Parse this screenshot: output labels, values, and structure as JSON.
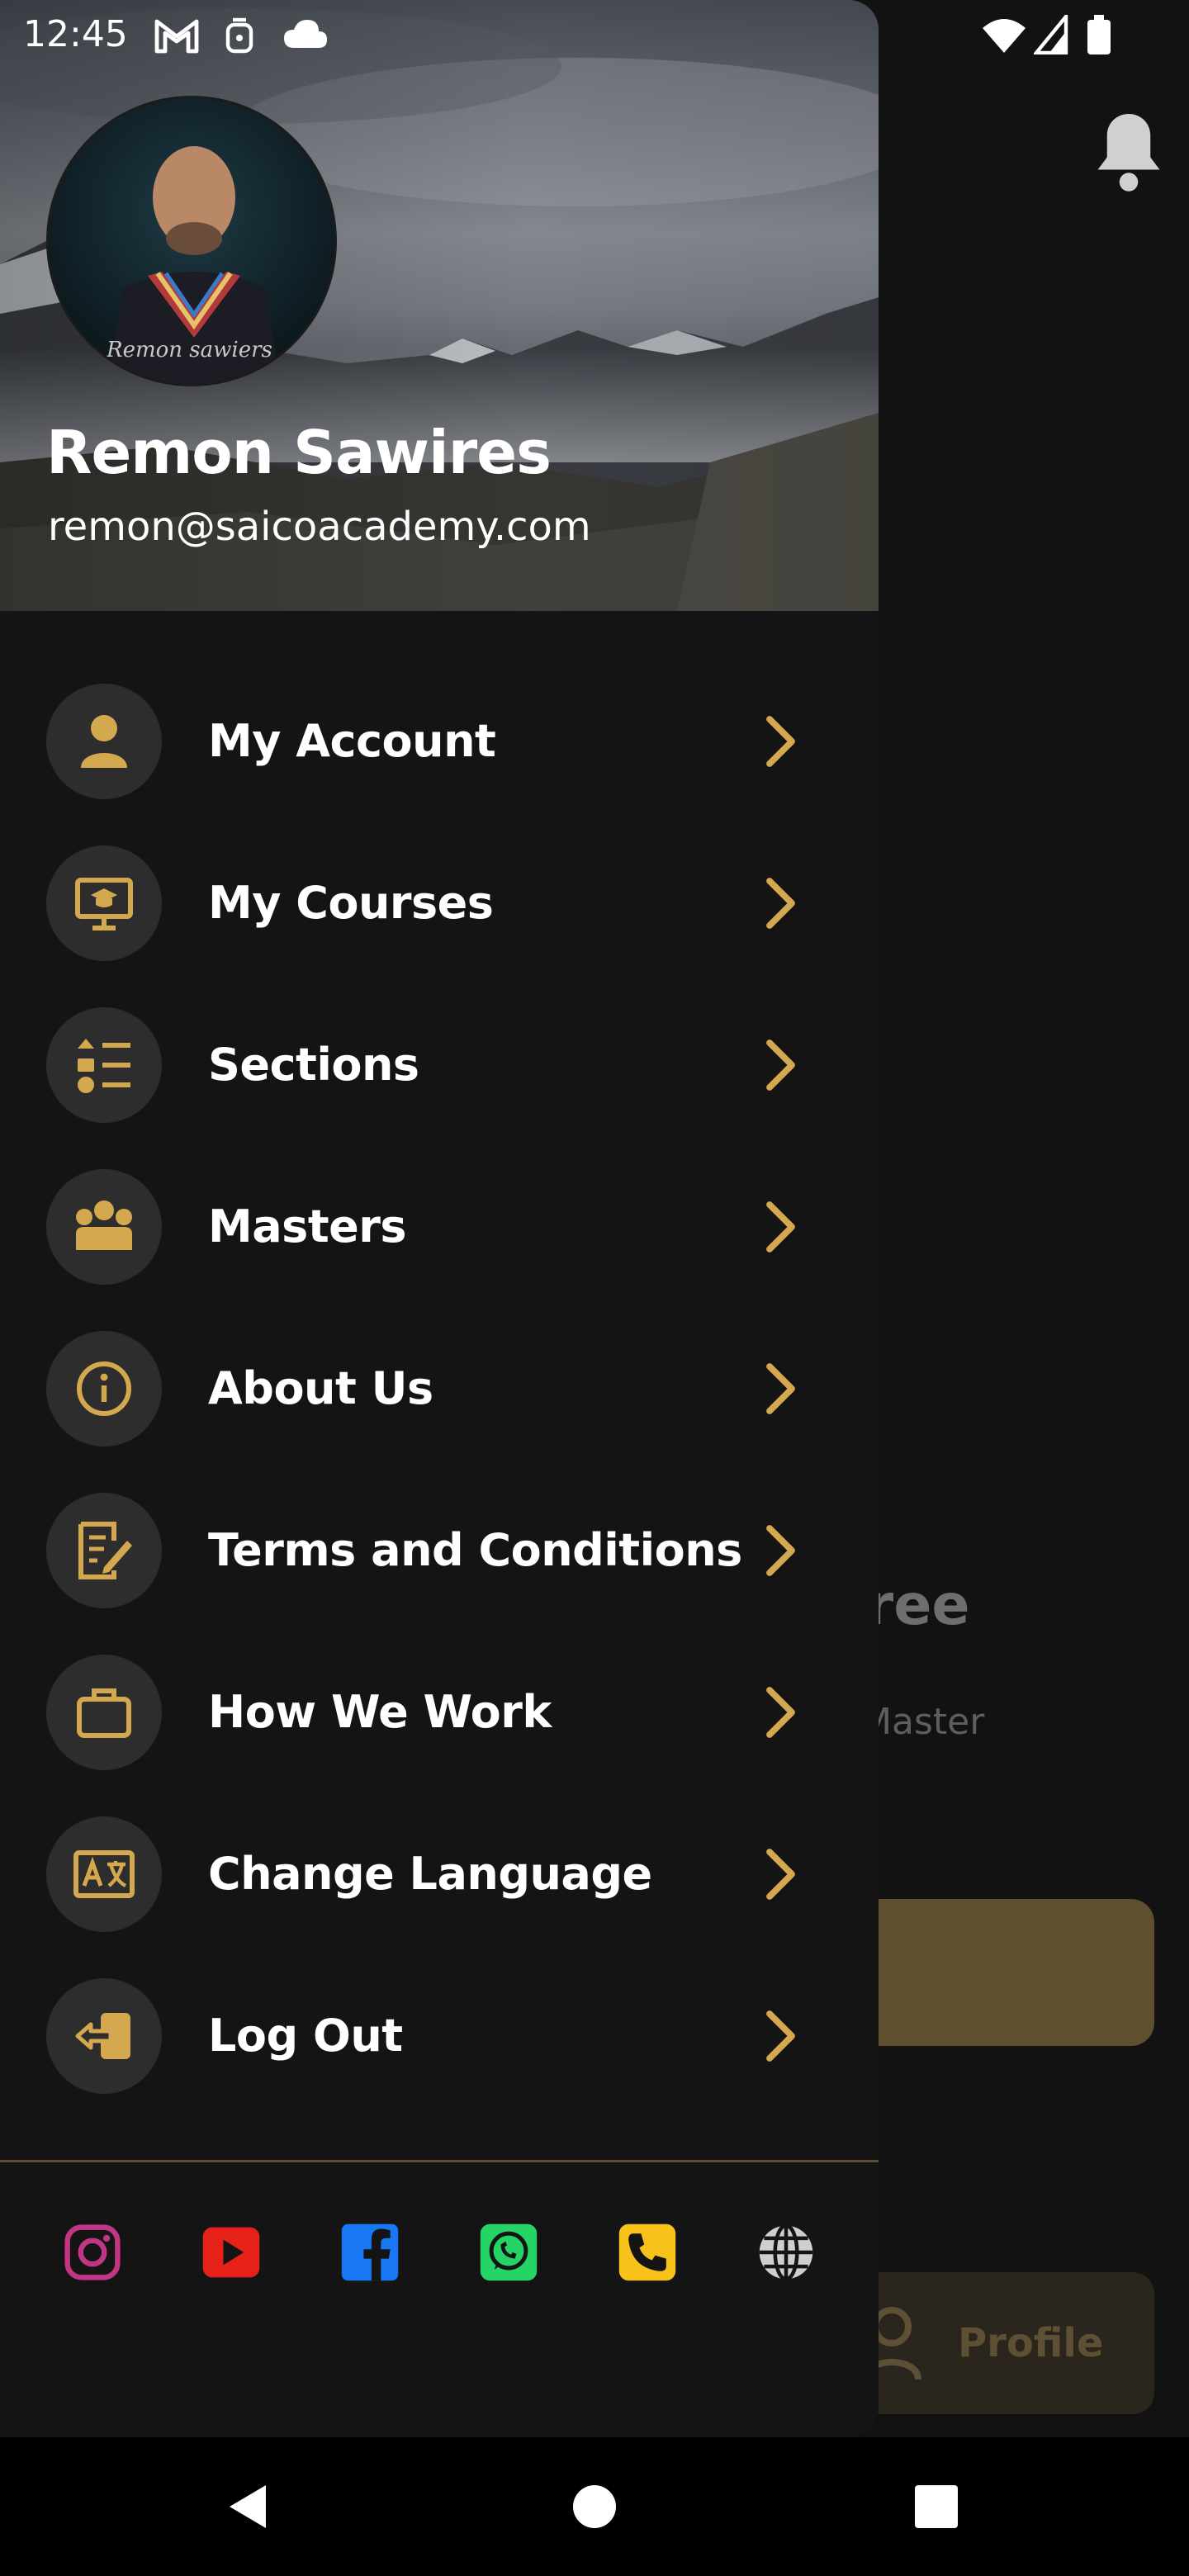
{
  "status_bar": {
    "time": "12:45"
  },
  "background_screen": {
    "title_fragment": "gree",
    "subtitle_fragment": "r Master",
    "tab_label": "Profile"
  },
  "drawer": {
    "user": {
      "name": "Remon Sawires",
      "email": "remon@saicoacademy.com",
      "avatar_signature": "Remon sawiers"
    },
    "menu": [
      {
        "label": "My Account",
        "icon": "person-icon"
      },
      {
        "label": "My Courses",
        "icon": "presentation-board-icon"
      },
      {
        "label": "Sections",
        "icon": "list-icon"
      },
      {
        "label": "Masters",
        "icon": "group-icon"
      },
      {
        "label": "About Us",
        "icon": "info-icon"
      },
      {
        "label": "Terms and Conditions",
        "icon": "document-edit-icon"
      },
      {
        "label": "How We Work",
        "icon": "briefcase-icon"
      },
      {
        "label": "Change Language",
        "icon": "translate-icon"
      },
      {
        "label": "Log Out",
        "icon": "logout-icon"
      }
    ],
    "socials": [
      {
        "name": "instagram",
        "color": "#c13584"
      },
      {
        "name": "youtube",
        "color": "#e62117"
      },
      {
        "name": "facebook",
        "color": "#1877f2"
      },
      {
        "name": "whatsapp",
        "color": "#25d366"
      },
      {
        "name": "phone",
        "color": "#f7c31a"
      },
      {
        "name": "website",
        "color": "#cfcfcf"
      }
    ]
  },
  "colors": {
    "accent": "#d4a84e",
    "drawer_bg": "#141414",
    "icon_circle": "#2d2d2d"
  }
}
